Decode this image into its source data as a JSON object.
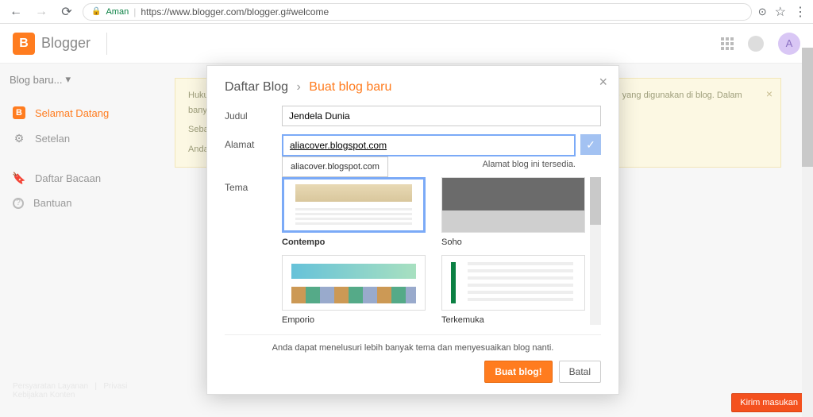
{
  "browser": {
    "secure_label": "Aman",
    "url": "https://www.blogger.com/blogger.g#welcome"
  },
  "header": {
    "brand": "Blogger",
    "avatar_initial": "A"
  },
  "sidebar": {
    "blog_dropdown": "Blog baru...",
    "items": [
      {
        "label": "Selamat Datang"
      },
      {
        "label": "Setelan"
      },
      {
        "label": "Daftar Bacaan"
      },
      {
        "label": "Bantuan"
      }
    ]
  },
  "notice": {
    "lines": [
      "Hukum Uni Eropa mewajibkan Anda untuk memberikan informasi kepada pengunjung Uni Eropa tentang cookie yang digunakan di blog. Dalam banyak ...",
      "Sebagai ... Google akan cookie Blogger dan Google ...",
      "Anda ... ditampilkan. Jika Anda mengg... berfungsi. Pelajari lebih lanjut tent..."
    ]
  },
  "footer": {
    "terms": "Persyaratan Layanan",
    "privacy": "Privasi",
    "content": "Kebijakan Konten"
  },
  "feedback_label": "Kirim masukan",
  "modal": {
    "crumb_root": "Daftar Blog",
    "crumb_current": "Buat blog baru",
    "labels": {
      "judul": "Judul",
      "alamat": "Alamat",
      "tema": "Tema"
    },
    "judul_value": "Jendela Dunia",
    "alamat_value": "aliacover.blogspot.com",
    "suggestion": "aliacover.blogspot.com",
    "availability": "Alamat blog ini tersedia.",
    "themes": [
      {
        "name": "Contempo",
        "selected": true
      },
      {
        "name": "Soho",
        "selected": false
      },
      {
        "name": "Emporio",
        "selected": false
      },
      {
        "name": "Terkemuka",
        "selected": false
      }
    ],
    "note": "Anda dapat menelusuri lebih banyak tema dan menyesuaikan blog nanti.",
    "primary_btn": "Buat blog!",
    "cancel_btn": "Batal"
  }
}
